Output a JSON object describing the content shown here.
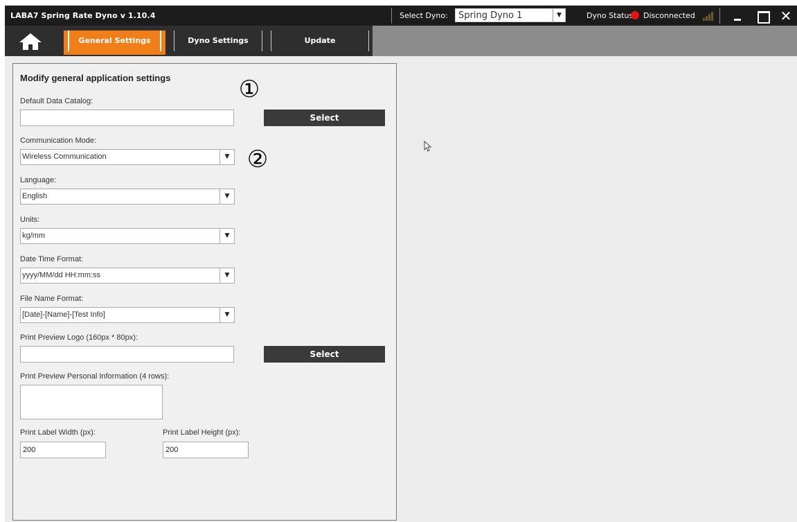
{
  "titlebar": {
    "app_title": "LABA7 Spring Rate Dyno  v 1.10.4",
    "select_dyno_label": "Select Dyno:",
    "selected_dyno": "Spring Dyno 1",
    "dyno_status_label": "Dyno Status:",
    "dyno_status": "Disconnected",
    "status_color": "#e81010"
  },
  "nav": {
    "home_icon": "home-icon",
    "tabs": [
      {
        "label": "General Settings",
        "active": true
      },
      {
        "label": "Dyno Settings",
        "active": false
      },
      {
        "label": "Update",
        "active": false
      }
    ],
    "accent_color": "#f07f1a"
  },
  "panel": {
    "title": "Modify general application settings",
    "default_data_catalog_label": "Default Data Catalog:",
    "default_data_catalog_value": "",
    "select_label": "Select",
    "communication_mode_label": "Communication Mode:",
    "communication_mode_value": "Wireless Communication",
    "language_label": "Language:",
    "language_value": "English",
    "units_label": "Units:",
    "units_value": "kg/mm",
    "date_time_format_label": "Date Time Format:",
    "date_time_format_value": "yyyy/MM/dd HH:mm:ss",
    "file_name_format_label": "File Name Format:",
    "file_name_format_value": "[Date]-[Name]-[Test Info]",
    "print_logo_label": "Print Preview Logo (160px * 80px):",
    "print_logo_value": "",
    "print_personal_info_label": "Print Preview Personal Information (4 rows):",
    "print_label_width_label": "Print Label Width (px):",
    "print_label_width_value": "200",
    "print_label_height_label": "Print Label Height (px):",
    "print_label_height_value": "200"
  },
  "annotations": {
    "marker_1": "①",
    "marker_2": "②"
  }
}
